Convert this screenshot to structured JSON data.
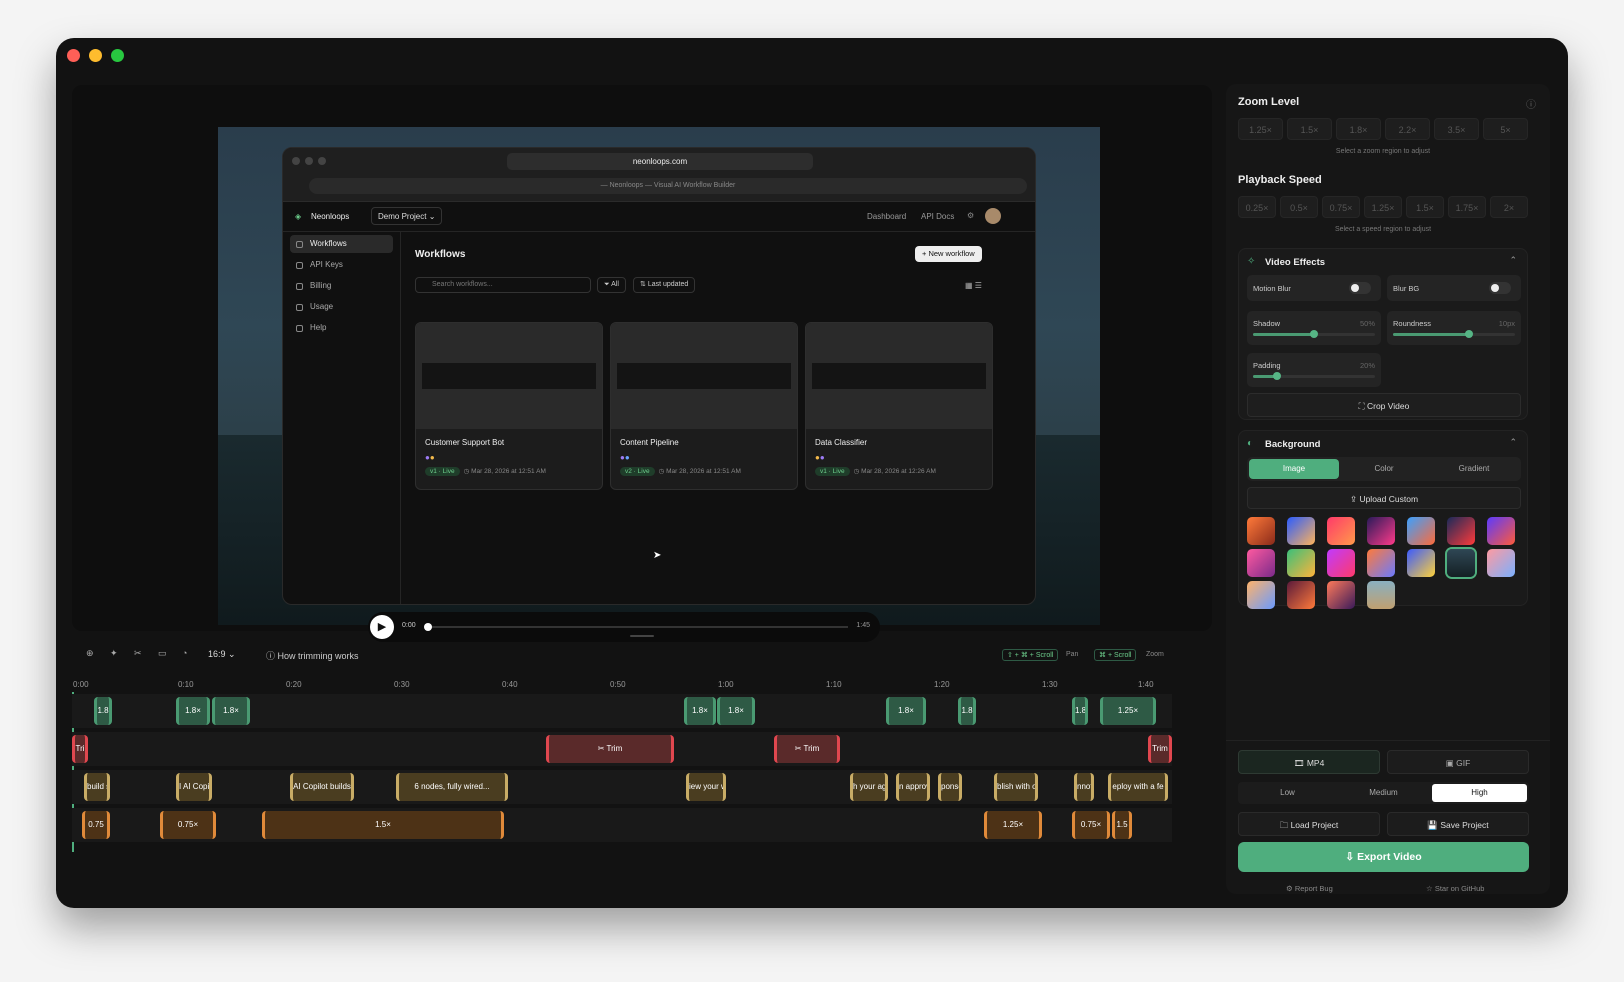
{
  "browser": {
    "url": "neonloops.com",
    "page_title": "— Neonloops — Visual AI Workflow Builder",
    "app_name": "Neonloops",
    "project": "Demo Project",
    "nav": [
      "Dashboard",
      "API Docs"
    ],
    "sidebar": [
      "Workflows",
      "API Keys",
      "Billing",
      "Usage",
      "Help"
    ],
    "heading": "Workflows",
    "new_button": "New workflow",
    "search_placeholder": "Search workflows...",
    "filter_label": "All",
    "sort_label": "Last updated",
    "cards": [
      {
        "name": "Customer Support Bot",
        "version": "v1 · Live",
        "date": "Mar 28, 2026 at 12:51 AM",
        "dots": [
          "#9d7bf5",
          "#f2b94b"
        ]
      },
      {
        "name": "Content Pipeline",
        "version": "v2 · Live",
        "date": "Mar 28, 2026 at 12:51 AM",
        "dots": [
          "#9d7bf5",
          "#6aa3ff"
        ]
      },
      {
        "name": "Data Classifier",
        "version": "v1 · Live",
        "date": "Mar 28, 2026 at 12:26 AM",
        "dots": [
          "#f2b94b",
          "#9d7bf5"
        ]
      }
    ]
  },
  "player": {
    "current_time": "0:00",
    "duration": "1:45"
  },
  "toolbar": {
    "aspect": "16:9",
    "help": "How trimming works",
    "pan_shortcut": "⇧ + ⌘ + Scroll",
    "pan_label": "Pan",
    "zoom_shortcut": "⌘ + Scroll",
    "zoom_label": "Zoom"
  },
  "timeline": {
    "ticks": [
      "0:00",
      "0:10",
      "0:20",
      "0:30",
      "0:40",
      "0:50",
      "1:00",
      "1:10",
      "1:20",
      "1:30",
      "1:40"
    ],
    "zoom_clips": [
      "1.8",
      "1.8×",
      "1.8×",
      "1.8×",
      "1.8×",
      "1.8×",
      "1.8",
      "1.8",
      "1.25×"
    ],
    "trim_clips": [
      "Tri",
      "Trim",
      "Trim",
      "Trim"
    ],
    "annotation_clips": [
      "build s",
      "I AI Copil",
      "AI Copilot builds",
      "6 nodes, fully wired...",
      "iew your w",
      "h your ag",
      "n approv",
      "ponse",
      "blish with o",
      "nnot",
      "eploy with a fe"
    ],
    "speed_clips": [
      "0.75",
      "0.75×",
      "1.5×",
      "1.25×",
      "0.75×",
      "1.5"
    ]
  },
  "sidebar": {
    "zoom_title": "Zoom Level",
    "zoom_levels": [
      "1.25×",
      "1.5×",
      "1.8×",
      "2.2×",
      "3.5×",
      "5×"
    ],
    "zoom_hint": "Select a zoom region to adjust",
    "speed_title": "Playback Speed",
    "speeds": [
      "0.25×",
      "0.5×",
      "0.75×",
      "1.25×",
      "1.5×",
      "1.75×",
      "2×"
    ],
    "speed_hint": "Select a speed region to adjust",
    "effects_title": "Video Effects",
    "motion_blur": "Motion Blur",
    "blur_bg": "Blur BG",
    "shadow": "Shadow",
    "shadow_value": "50%",
    "shadow_level": 0.5,
    "roundness": "Roundness",
    "roundness_value": "10px",
    "roundness_level": 0.62,
    "padding": "Padding",
    "padding_value": "20%",
    "padding_level": 0.2,
    "crop": "Crop Video",
    "bg_title": "Background",
    "bg_tabs": [
      "Image",
      "Color",
      "Gradient"
    ],
    "upload": "Upload Custom",
    "formats": [
      "MP4",
      "GIF"
    ],
    "qualities": [
      "Low",
      "Medium",
      "High"
    ],
    "load": "Load Project",
    "save": "Save Project",
    "export": "Export Video",
    "report": "Report Bug",
    "star": "Star on GitHub",
    "accent": "#4fae7e"
  }
}
